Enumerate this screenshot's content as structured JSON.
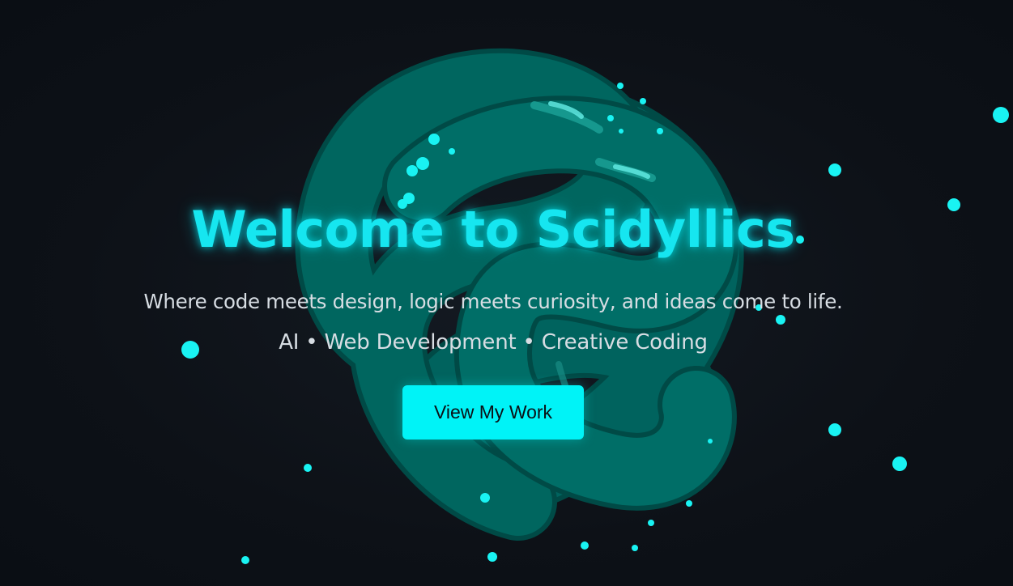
{
  "hero": {
    "title": "Welcome to Scidyllics",
    "subtitle": "Where code meets design, logic meets curiosity, and ideas come to life.",
    "topics": "AI • Web Development • Creative Coding",
    "cta_label": "View My Work"
  },
  "colors": {
    "background": "#0d1117",
    "accent": "#00f3f7",
    "title_glow": "#16e6f0",
    "knot": "#00756e",
    "particle": "#19f3f3",
    "text_light": "#d7dde3"
  },
  "icons": {
    "scene_object": "torus-knot-3d",
    "particles": "glowing-particle-dots"
  }
}
